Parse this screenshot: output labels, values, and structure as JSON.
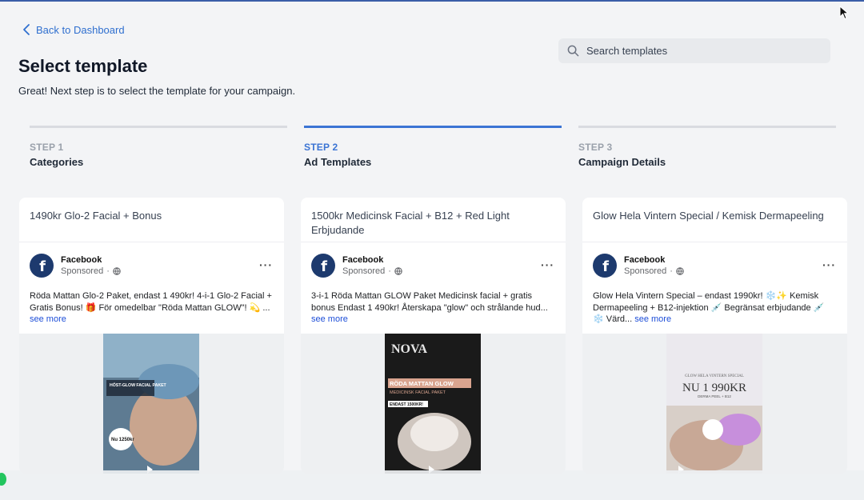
{
  "nav": {
    "back_label": "Back to Dashboard"
  },
  "header": {
    "title": "Select template",
    "subtitle": "Great! Next step is to select the template for your campaign."
  },
  "search": {
    "placeholder": "Search templates",
    "value": ""
  },
  "steps": [
    {
      "num": "STEP 1",
      "name": "Categories",
      "active": false
    },
    {
      "num": "STEP 2",
      "name": "Ad Templates",
      "active": true
    },
    {
      "num": "STEP 3",
      "name": "Campaign Details",
      "active": false
    }
  ],
  "cards": [
    {
      "title": "1490kr Glo-2 Facial + Bonus",
      "page_name": "Facebook",
      "sponsored": "Sponsored",
      "text": "Röda Mattan Glo-2 Paket, endast 1 490kr! 4-i-1 Glo-2 Facial + Gratis Bonus! 🎁 För omedelbar \"Röda Mattan GLOW\"! 💫 ...",
      "see_more": "see more",
      "image_text": [
        "HÖST-GLOW FACIAL PAKET",
        "Nu 1250kr"
      ]
    },
    {
      "title": "1500kr Medicinsk Facial + B12 + Red Light Erbjudande",
      "page_name": "Facebook",
      "sponsored": "Sponsored",
      "text": "3-i-1 Röda Mattan GLOW Paket Medicinsk facial + gratis bonus Endast 1 490kr! Återskapa \"glow\" och strålande hud...",
      "see_more": "see more",
      "image_text": [
        "NOVA",
        "RÖDA MATTAN GLOW",
        "MEDICINSK FACIAL PAKET",
        "ENDAST 1500KR!"
      ]
    },
    {
      "title": "Glow Hela Vintern Special / Kemisk Dermapeeling",
      "page_name": "Facebook",
      "sponsored": "Sponsored",
      "text": "Glow Hela Vintern Special – endast 1990kr! ❄️✨ Kemisk Dermapeeling + B12-injektion 💉 Begränsat erbjudande 💉 ❄️ Värd...",
      "see_more": "see more",
      "image_text": [
        "GLOW HELA VINTERN SPECIAL",
        "NU 1 990KR",
        "DERMA PEEL + B12"
      ]
    }
  ],
  "icons": {
    "back": "chevron-left-icon",
    "search": "search-icon",
    "brand": "facebook-logo-icon",
    "globe": "globe-icon",
    "more": "more-dots-icon"
  },
  "colors": {
    "accent": "#3b74d4",
    "link": "#2f6fcf",
    "inactive_step": "#9aa1ab",
    "facebook": "#1d3a6e"
  }
}
